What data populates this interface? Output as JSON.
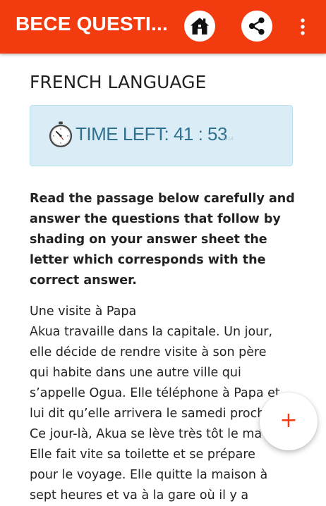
{
  "app_bar": {
    "title": "BECE QUESTI...",
    "background": "#f23c10",
    "icons": {
      "home": "home-icon",
      "share": "share-icon",
      "more": "more-vertical-icon"
    }
  },
  "main": {
    "subject_title": "FRENCH LANGUAGE",
    "timer": {
      "icon": "clock-icon",
      "text": "TIME LEFT: 41 : 53",
      "sub": "2414",
      "color": "#31708f",
      "background": "#daedf7"
    },
    "instructions": "Read the passage below carefully and answer the questions that follow by shading on your answer sheet the letter which corresponds with the correct answer.",
    "passage_lines": [
      "Une visite à Papa",
      "Akua travaille dans la capitale. Un jour,",
      "elle décide de rendre visite à son père",
      "qui habite dans une autre ville qui",
      "s’appelle Ogua. Elle téléphone à Papa et",
      "lui dit qu’elle arrivera le samedi proch",
      "Ce jour-là, Akua se lève très tôt le ma",
      "Elle fait vite sa toilette et se prépare",
      "pour le voyage. Elle quitte la maison à",
      "sept heures et va à la gare où il y a"
    ]
  },
  "fab": {
    "label": "+",
    "icon": "plus-icon"
  }
}
